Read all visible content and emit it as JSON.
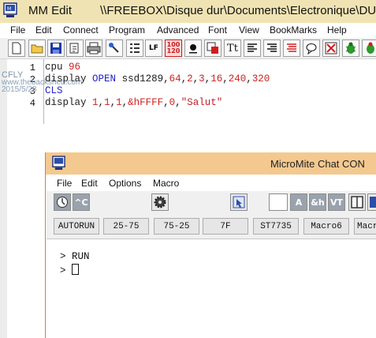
{
  "editor": {
    "app_title": "MM Edit",
    "file_path": "\\\\FREEBOX\\Disque dur\\Documents\\Electronique\\DUI",
    "menu": [
      "File",
      "Edit",
      "Connect",
      "Program",
      "Advanced",
      "Font",
      "View",
      "BookMarks",
      "Help"
    ],
    "toolbar_text": {
      "list_label": "LF",
      "sample_top": "100",
      "sample_bottom": "120",
      "font_tt": "Tt"
    },
    "line_numbers": [
      "1",
      "2",
      "3",
      "4"
    ],
    "code": {
      "line1_kw": "cpu",
      "line1_num": "96",
      "line2_kw": "display",
      "line2_kw2": "OPEN",
      "line2_dev": "ssd1289",
      "line2_args": [
        "64",
        "2",
        "3",
        "16",
        "240",
        "320"
      ],
      "line3_kw": "CLS",
      "line4_kw": "display",
      "line4_args": [
        "1",
        "1",
        "1",
        "&hFFFF",
        "0"
      ],
      "line4_str": "\"Salut\""
    },
    "watermark": {
      "line1": "CFLY",
      "line2": "www.thebackshed.com",
      "line3": "2015/5/28"
    }
  },
  "chat": {
    "title": "MicroMite Chat  CON",
    "menu": [
      "File",
      "Edit",
      "Options",
      "Macro"
    ],
    "toolbar_text": {
      "ctrl_c": "^C",
      "a": "A",
      "amp_h": "&h",
      "vt": "VT"
    },
    "macros": [
      "AUTORUN",
      "25-75",
      "75-25",
      "7F",
      "ST7735",
      "Macro6",
      "Macr"
    ],
    "terminal": {
      "prompt": ">",
      "line1_cmd": "RUN"
    }
  },
  "colors": {
    "editor_titlebar": "#f0e3b3",
    "chat_titlebar": "#f4c98f",
    "keyword": "#2222cc",
    "number": "#cc2222",
    "string": "#c0202a"
  },
  "icons": [
    "app-icon",
    "new-file-icon",
    "open-folder-icon",
    "save-icon",
    "cut-icon",
    "print-icon",
    "run-icon",
    "list-icon",
    "lf-icon",
    "dot-icon",
    "red-square-icon",
    "text-style-icon",
    "align-left-icon",
    "align-right-icon",
    "red-lines-icon",
    "speech-bubble-icon",
    "cancel-icon",
    "bug-icon",
    "clock-icon",
    "gear-icon",
    "cursor-icon",
    "blank-icon",
    "panel-icon"
  ]
}
